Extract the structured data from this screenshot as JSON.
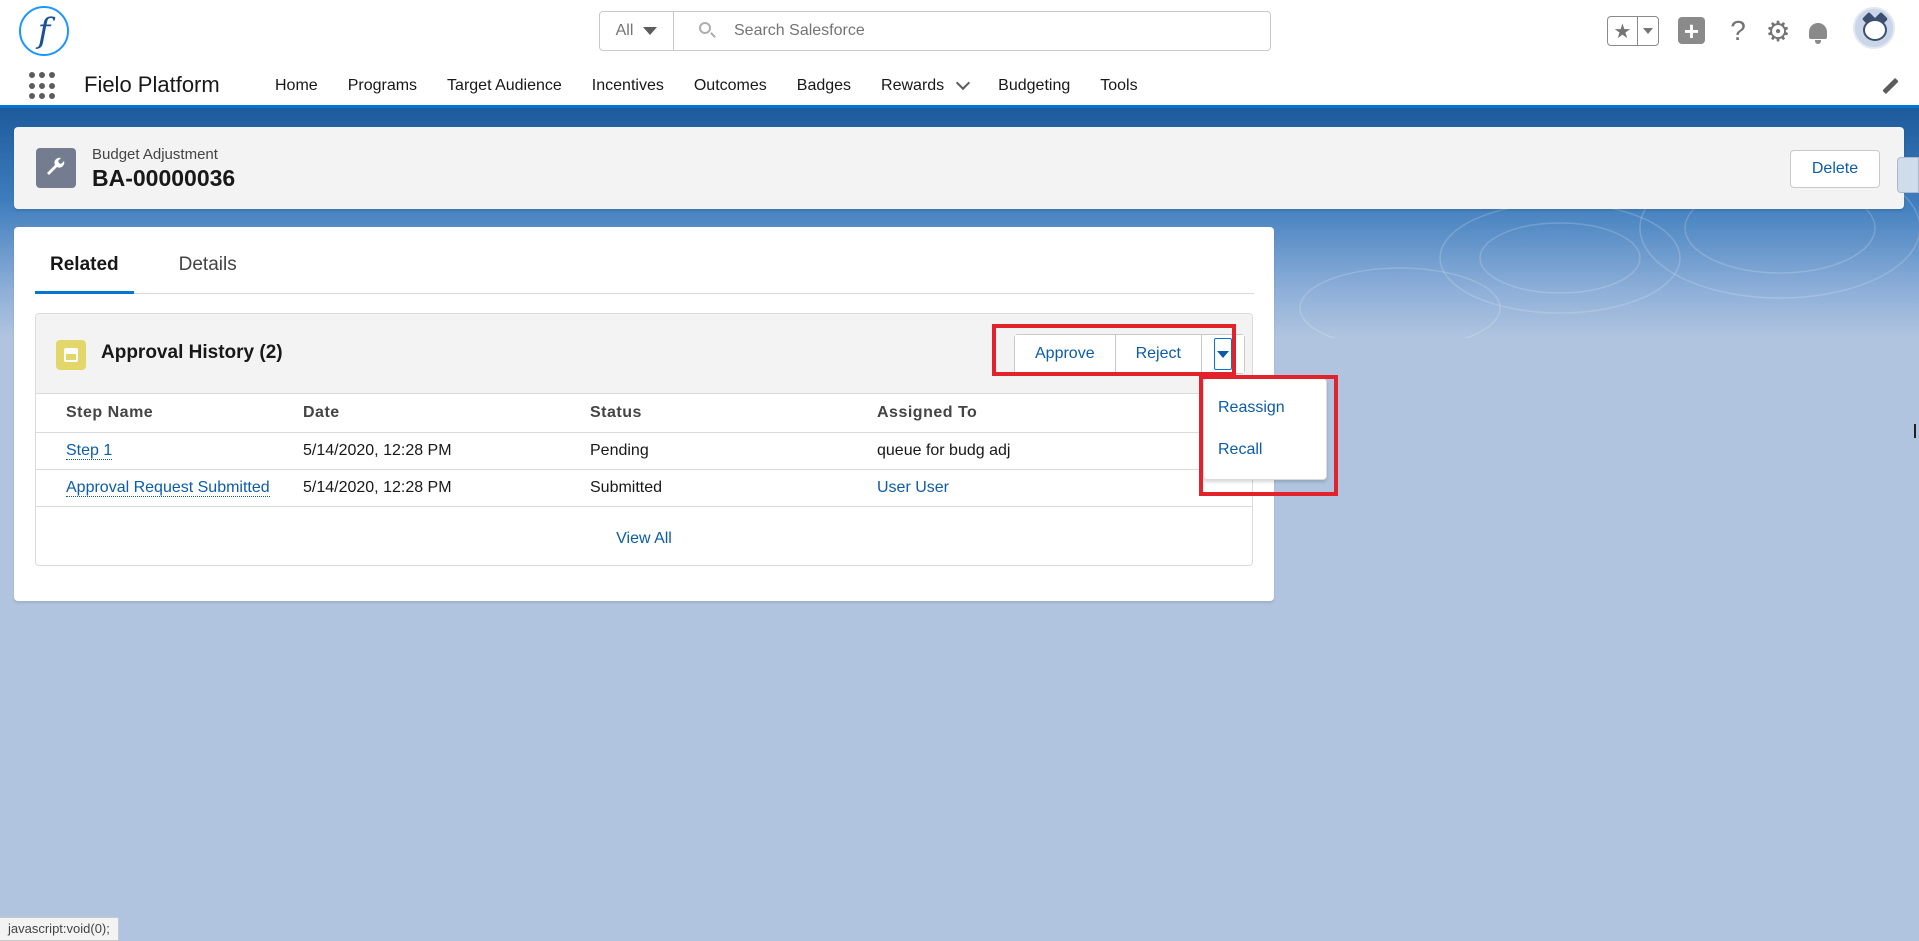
{
  "header": {
    "logo_letter": "f",
    "search": {
      "scope": "All",
      "placeholder": "Search Salesforce"
    },
    "icons": [
      "favorites-icon",
      "add-icon",
      "help-icon",
      "settings-icon",
      "notifications-icon",
      "avatar"
    ]
  },
  "nav": {
    "app_name": "Fielo Platform",
    "items": [
      "Home",
      "Programs",
      "Target Audience",
      "Incentives",
      "Outcomes",
      "Badges",
      "Rewards",
      "Budgeting",
      "Tools"
    ]
  },
  "record": {
    "type": "Budget Adjustment",
    "name": "BA-00000036",
    "delete_label": "Delete"
  },
  "tabs": {
    "related": "Related",
    "details": "Details"
  },
  "approval": {
    "title": "Approval History (2)",
    "approve_label": "Approve",
    "reject_label": "Reject",
    "columns": [
      "Step Name",
      "Date",
      "Status",
      "Assigned To"
    ],
    "rows": [
      {
        "step": "Step 1",
        "date": "5/14/2020, 12:28 PM",
        "status": "Pending",
        "assigned": "queue for budg adj"
      },
      {
        "step": "Approval Request Submitted",
        "date": "5/14/2020, 12:28 PM",
        "status": "Submitted",
        "assigned": "User User"
      }
    ],
    "view_all": "View All"
  },
  "menu": {
    "items": [
      "Reassign",
      "Recall"
    ]
  },
  "status_bar": "javascript:void(0);",
  "colors": {
    "brand": "#0176d3",
    "link": "#0b5cab",
    "highlight": "#e3232c",
    "background": "#b0c4df"
  }
}
